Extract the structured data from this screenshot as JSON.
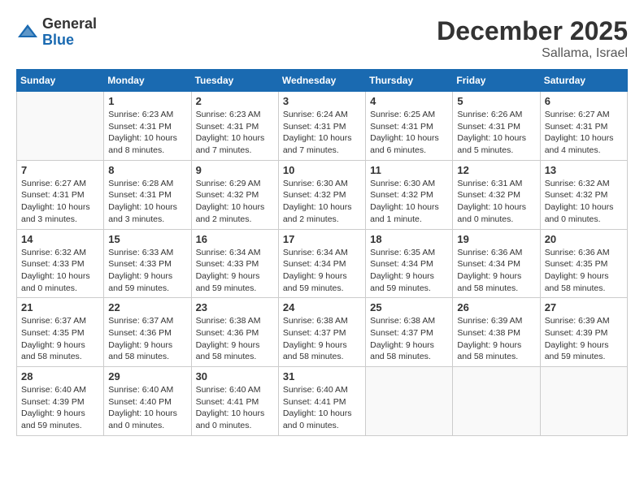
{
  "header": {
    "logo_general": "General",
    "logo_blue": "Blue",
    "month_title": "December 2025",
    "location": "Sallama, Israel"
  },
  "weekdays": [
    "Sunday",
    "Monday",
    "Tuesday",
    "Wednesday",
    "Thursday",
    "Friday",
    "Saturday"
  ],
  "weeks": [
    [
      {
        "day": "",
        "info": ""
      },
      {
        "day": "1",
        "info": "Sunrise: 6:23 AM\nSunset: 4:31 PM\nDaylight: 10 hours\nand 8 minutes."
      },
      {
        "day": "2",
        "info": "Sunrise: 6:23 AM\nSunset: 4:31 PM\nDaylight: 10 hours\nand 7 minutes."
      },
      {
        "day": "3",
        "info": "Sunrise: 6:24 AM\nSunset: 4:31 PM\nDaylight: 10 hours\nand 7 minutes."
      },
      {
        "day": "4",
        "info": "Sunrise: 6:25 AM\nSunset: 4:31 PM\nDaylight: 10 hours\nand 6 minutes."
      },
      {
        "day": "5",
        "info": "Sunrise: 6:26 AM\nSunset: 4:31 PM\nDaylight: 10 hours\nand 5 minutes."
      },
      {
        "day": "6",
        "info": "Sunrise: 6:27 AM\nSunset: 4:31 PM\nDaylight: 10 hours\nand 4 minutes."
      }
    ],
    [
      {
        "day": "7",
        "info": "Sunrise: 6:27 AM\nSunset: 4:31 PM\nDaylight: 10 hours\nand 3 minutes."
      },
      {
        "day": "8",
        "info": "Sunrise: 6:28 AM\nSunset: 4:31 PM\nDaylight: 10 hours\nand 3 minutes."
      },
      {
        "day": "9",
        "info": "Sunrise: 6:29 AM\nSunset: 4:32 PM\nDaylight: 10 hours\nand 2 minutes."
      },
      {
        "day": "10",
        "info": "Sunrise: 6:30 AM\nSunset: 4:32 PM\nDaylight: 10 hours\nand 2 minutes."
      },
      {
        "day": "11",
        "info": "Sunrise: 6:30 AM\nSunset: 4:32 PM\nDaylight: 10 hours\nand 1 minute."
      },
      {
        "day": "12",
        "info": "Sunrise: 6:31 AM\nSunset: 4:32 PM\nDaylight: 10 hours\nand 0 minutes."
      },
      {
        "day": "13",
        "info": "Sunrise: 6:32 AM\nSunset: 4:32 PM\nDaylight: 10 hours\nand 0 minutes."
      }
    ],
    [
      {
        "day": "14",
        "info": "Sunrise: 6:32 AM\nSunset: 4:33 PM\nDaylight: 10 hours\nand 0 minutes."
      },
      {
        "day": "15",
        "info": "Sunrise: 6:33 AM\nSunset: 4:33 PM\nDaylight: 9 hours\nand 59 minutes."
      },
      {
        "day": "16",
        "info": "Sunrise: 6:34 AM\nSunset: 4:33 PM\nDaylight: 9 hours\nand 59 minutes."
      },
      {
        "day": "17",
        "info": "Sunrise: 6:34 AM\nSunset: 4:34 PM\nDaylight: 9 hours\nand 59 minutes."
      },
      {
        "day": "18",
        "info": "Sunrise: 6:35 AM\nSunset: 4:34 PM\nDaylight: 9 hours\nand 59 minutes."
      },
      {
        "day": "19",
        "info": "Sunrise: 6:36 AM\nSunset: 4:34 PM\nDaylight: 9 hours\nand 58 minutes."
      },
      {
        "day": "20",
        "info": "Sunrise: 6:36 AM\nSunset: 4:35 PM\nDaylight: 9 hours\nand 58 minutes."
      }
    ],
    [
      {
        "day": "21",
        "info": "Sunrise: 6:37 AM\nSunset: 4:35 PM\nDaylight: 9 hours\nand 58 minutes."
      },
      {
        "day": "22",
        "info": "Sunrise: 6:37 AM\nSunset: 4:36 PM\nDaylight: 9 hours\nand 58 minutes."
      },
      {
        "day": "23",
        "info": "Sunrise: 6:38 AM\nSunset: 4:36 PM\nDaylight: 9 hours\nand 58 minutes."
      },
      {
        "day": "24",
        "info": "Sunrise: 6:38 AM\nSunset: 4:37 PM\nDaylight: 9 hours\nand 58 minutes."
      },
      {
        "day": "25",
        "info": "Sunrise: 6:38 AM\nSunset: 4:37 PM\nDaylight: 9 hours\nand 58 minutes."
      },
      {
        "day": "26",
        "info": "Sunrise: 6:39 AM\nSunset: 4:38 PM\nDaylight: 9 hours\nand 58 minutes."
      },
      {
        "day": "27",
        "info": "Sunrise: 6:39 AM\nSunset: 4:39 PM\nDaylight: 9 hours\nand 59 minutes."
      }
    ],
    [
      {
        "day": "28",
        "info": "Sunrise: 6:40 AM\nSunset: 4:39 PM\nDaylight: 9 hours\nand 59 minutes."
      },
      {
        "day": "29",
        "info": "Sunrise: 6:40 AM\nSunset: 4:40 PM\nDaylight: 10 hours\nand 0 minutes."
      },
      {
        "day": "30",
        "info": "Sunrise: 6:40 AM\nSunset: 4:41 PM\nDaylight: 10 hours\nand 0 minutes."
      },
      {
        "day": "31",
        "info": "Sunrise: 6:40 AM\nSunset: 4:41 PM\nDaylight: 10 hours\nand 0 minutes."
      },
      {
        "day": "",
        "info": ""
      },
      {
        "day": "",
        "info": ""
      },
      {
        "day": "",
        "info": ""
      }
    ]
  ]
}
